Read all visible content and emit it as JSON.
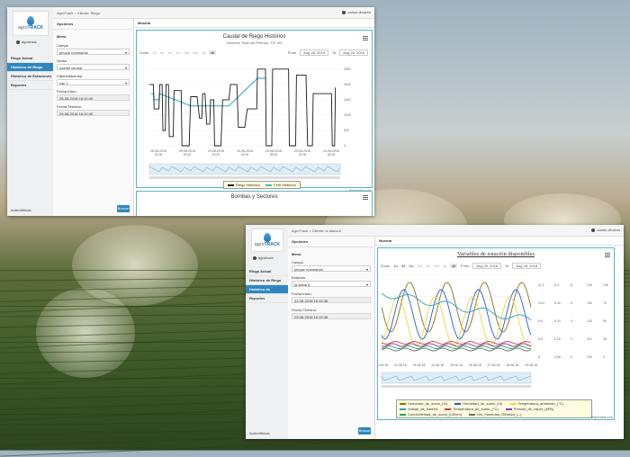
{
  "window1": {
    "breadcrumb": "AgroTrack > Cliente: Riego",
    "user": "carlos olivares",
    "logo": {
      "a": "agro",
      "b": "TRACK"
    },
    "username": "agrotrack",
    "nav": [
      "Riego Actual",
      "Histórico de Riego",
      "Histórico de Estaciones",
      "Reportes"
    ],
    "active_nav": 1,
    "footer": "Autentifikkas",
    "options": {
      "title": "Opciones",
      "section": "Menú",
      "campo_label": "Campo",
      "campo_value": "pinque huemamm",
      "sector_label": "Sector",
      "sector_value": "cuartel central",
      "cabezal_label": "Cabezal/bomba",
      "cabezal_value": "cab 1",
      "start_label": "Fecha Inicio:",
      "start_value": "28-08-2018 18:10:40",
      "end_label": "Fecha Término:",
      "end_value": "29-08-2018 18:10:40",
      "button": "Buscar"
    },
    "main_head": "Mostrar",
    "chart": {
      "title": "Caudal de Riego Histórico",
      "subtitle": "Volumen Total del Período: 757 m3",
      "zoom_label": "Zoom",
      "zoom_buttons": [
        "1d",
        "3d",
        "1w",
        "1m",
        "3m",
        "6m",
        "1y",
        "all"
      ],
      "from_label": "From",
      "from_value": "Aug 28, 2018",
      "to_label": "To",
      "to_value": "Aug 29, 2018",
      "credit": "Highcharts.com",
      "legend": [
        "Riego Histórico",
        "Ferti Histórico"
      ]
    },
    "second_panel_title": "Bombas y Sectores"
  },
  "window2": {
    "breadcrumb": "AgroTrack > Cliente: la diana A",
    "user": "carlos olivares",
    "logo": {
      "a": "agro",
      "b": "TRACK"
    },
    "username": "agrotrack",
    "nav": [
      "Riego Actual",
      "Histórico de Riego",
      "Histórico de Estaciones",
      "Reportes"
    ],
    "active_nav": 2,
    "footer": "Autentifikkas",
    "options": {
      "title": "Opciones",
      "section": "Menú",
      "campo_label": "Campo",
      "campo_value": "pinque huemamm",
      "estacion_label": "Estación",
      "estacion_value": "la diana A",
      "start_label": "Fecha Inicio:",
      "start_value": "22-08-2018 16:15:38",
      "end_label": "Fecha Término:",
      "end_value": "29-08-2018 16:15:38",
      "button": "Buscar"
    },
    "main_head": "Mostrar",
    "chart": {
      "title": "Variables de estación disponibles",
      "zoom_label": "Zoom",
      "zoom_buttons": [
        "1d",
        "3d",
        "1w",
        "1m",
        "3m",
        "6m",
        "1y",
        "all"
      ],
      "from_label": "From",
      "from_value": "Aug 20, 2018",
      "to_label": "To",
      "to_value": "Aug 29, 2018",
      "credit": "Highcharts.com",
      "legend": [
        "Humedad_de_suelo_(%)",
        "Humedad_de_suelo_(%)",
        "Temperatura_ambiente_(°C)",
        "Voltaje_de_batería",
        "Temperatura_de_suelo_(°C)",
        "Presión_de_vapor_(kPA)",
        "Conductividad_de_suelo_(uS/cm)",
        "Hrs_humedad_Relativa_(--)"
      ]
    }
  },
  "colors": {
    "accent": "#2e86c1",
    "panel_border": "#57b5c4",
    "riego": "#1a1a1a",
    "ferti": "#3fb6c9"
  },
  "chart_data": [
    {
      "type": "line",
      "title": "Caudal de Riego Histórico",
      "subtitle": "Volumen Total del Período: 757 m3",
      "x_ticks": [
        "28-08-2018 16:00",
        "28-08-2018 20:00",
        "29-08-2018 00:00",
        "29-08-2018 04:00",
        "29-08-2018 08:00",
        "29-08-2018 12:00",
        "29-08-2018 16:00"
      ],
      "y_ticks": [
        0,
        500,
        1000,
        1500,
        2000,
        2500
      ],
      "series": [
        {
          "name": "Riego Histórico",
          "x": [
            0,
            0.5,
            0.6,
            1.2,
            1.3,
            1.6,
            1.7,
            2.0,
            2.1,
            2.4,
            2.5,
            3.0,
            3.1,
            4.0,
            4.1,
            5.0,
            5.2,
            6.0,
            6.3,
            6.6,
            6.7,
            7.0,
            7.2,
            7.6,
            7.7,
            8.1,
            8.2,
            9.0,
            9.2,
            10.0,
            10.2,
            11.0,
            11.2,
            12.0,
            12.3,
            13.5,
            13.6,
            14.6,
            14.7,
            15.4,
            15.5,
            17.5,
            17.6,
            18.4,
            18.5,
            19.7,
            19.9,
            20.5,
            20.6,
            22.9,
            23.0,
            23.3,
            23.4
          ],
          "y": [
            2000,
            2000,
            1200,
            1200,
            2000,
            2000,
            500,
            500,
            2000,
            2000,
            300,
            300,
            1800,
            1800,
            0,
            0,
            1600,
            1600,
            900,
            900,
            1700,
            1700,
            700,
            700,
            1500,
            1500,
            0,
            0,
            1500,
            1500,
            2000,
            2000,
            600,
            600,
            1200,
            1200,
            2500,
            2500,
            0,
            0,
            2500,
            2500,
            0,
            0,
            2300,
            2300,
            0,
            0,
            1700,
            1700,
            0,
            0,
            1900
          ]
        },
        {
          "name": "Ferti Histórico",
          "x": [
            0.2,
            0.5,
            0.6,
            1.2,
            1.3,
            5.2,
            6.0,
            9.2,
            10.0,
            13.6,
            14.6
          ],
          "y": [
            1700,
            1700,
            1500,
            1500,
            1700,
            1300,
            1300,
            1300,
            1300,
            2200,
            2200
          ]
        }
      ]
    },
    {
      "type": "line",
      "title": "Variables de estación disponibles",
      "x_ticks": [
        "21-08-18",
        "22-08-18",
        "23-08-18",
        "24-08-18",
        "25-08-18",
        "26-08-18",
        "27-08-18",
        "28-08-18",
        "29-08-18"
      ],
      "right_axis_ticks": [
        [
          "11.2",
          "10.4",
          "9.6",
          "8.8",
          "8"
        ],
        [
          "6.4",
          "6.32",
          "6.24",
          "6.16",
          "4.08"
        ],
        [
          "8",
          "6",
          "4",
          "2",
          "0"
        ],
        [
          "140",
          "130",
          "120",
          "110",
          "100"
        ],
        [
          "100",
          "75",
          "50",
          "25",
          "0"
        ]
      ],
      "series": [
        {
          "name": "Humedad_de_suelo_(%)",
          "color": "#8c6d1f",
          "shape": "daily-cycle"
        },
        {
          "name": "Humedad_de_suelo_(%)",
          "color": "#1f5ed6",
          "shape": "daily-cycle"
        },
        {
          "name": "Temperatura_ambiente_(°C)",
          "color": "#f1d53a",
          "shape": "daily-cycle"
        },
        {
          "name": "Voltaje_de_batería",
          "color": "#2aa3c8",
          "shape": "declining"
        },
        {
          "name": "Temperatura_de_suelo_(°C)",
          "color": "#e23b3b",
          "shape": "flat"
        },
        {
          "name": "Presión_de_vapor_(kPA)",
          "color": "#7a3fb0",
          "shape": "flat"
        },
        {
          "name": "Conductividad_de_suelo_(uS/cm)",
          "color": "#2ca05a",
          "shape": "flat"
        },
        {
          "name": "Hrs_humedad_Relativa_(--)",
          "color": "#6d6d6d",
          "shape": "flat"
        }
      ]
    }
  ]
}
